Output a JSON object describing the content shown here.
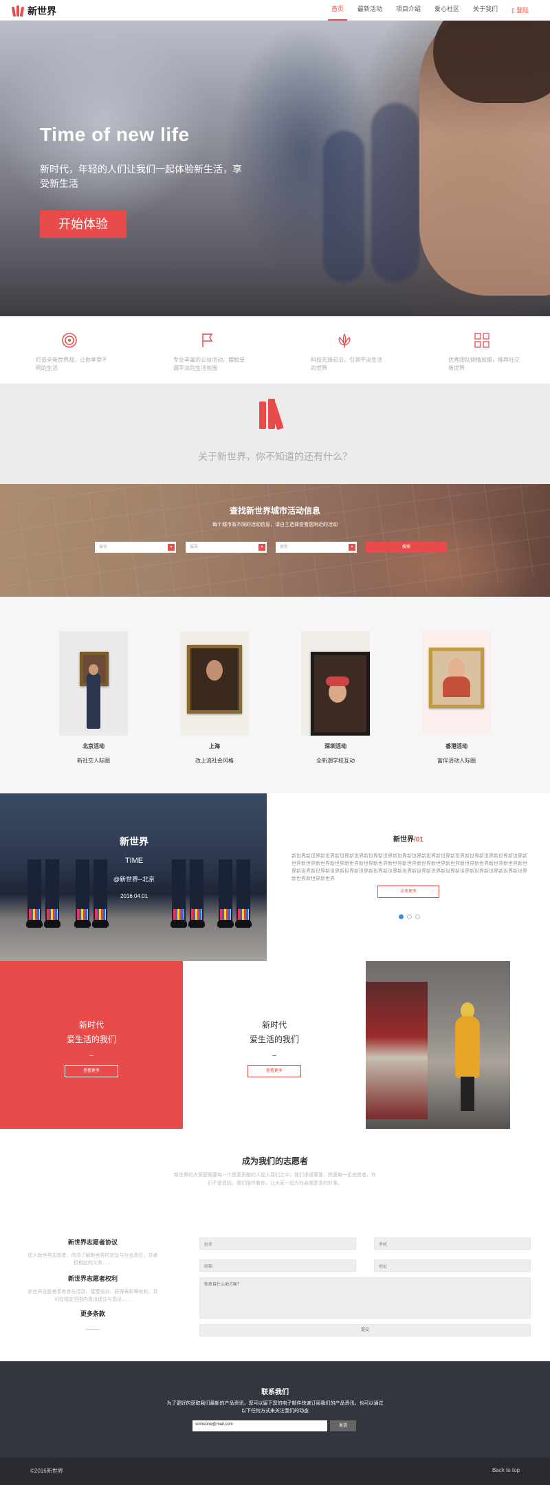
{
  "header": {
    "logo_text": "新世界",
    "nav": [
      "首页",
      "最新活动",
      "项目介绍",
      "爱心社区",
      "关于我们"
    ],
    "login": "登陆"
  },
  "hero": {
    "title": "Time of new life",
    "subtitle": "新时代，年轻的人们让我们一起体验新生活，享受新生活",
    "button": "开始体验"
  },
  "features": [
    "打造全新世界观，让你享受不同的生活",
    "专业丰富的公益活动，摆脱单调平淡的生活氛围",
    "科技先锋前沿，引领平淡生活的世界",
    "优秀团队倾情加盟，推荐社交新世界"
  ],
  "about": {
    "text": "关于新世界，你不知道的还有什么？"
  },
  "search": {
    "title": "查找新世界城市活动信息",
    "subtitle": "每个城市有不同的活动信息，请自主选择查看您附近的活动",
    "selects": [
      "省份",
      "城市",
      "类型"
    ],
    "button": "搜索"
  },
  "activities": [
    {
      "city": "北京活动",
      "desc": "新社交人际圈"
    },
    {
      "city": "上海",
      "desc": "改上流社会风格"
    },
    {
      "city": "深圳活动",
      "desc": "全新潮学校互动"
    },
    {
      "city": "香港活动",
      "desc": "富伴活动人际圈"
    }
  ],
  "story": {
    "overlay_title": "新世界",
    "overlay_word": "TIME",
    "overlay_place": "@新世界--北京",
    "overlay_date": "2016.04.01",
    "title": "新世界",
    "title_num": "/01",
    "body": "新世界新世界新世界新世界新世界新世界新世界新世界新世界新世界新世界新世界新世界新世界新世界新世界新世界新世界新世界新世界新世界新世界新世界新世界新世界新世界新世界新世界新世界新世界新世界新世界新世界新世界新世界新世界新世界新世界新世界新世界新世界新世界新世界新世界新世界新世界新世界新世界新世界新世界新世界新世界",
    "more": "点击更多"
  },
  "life": {
    "line1": "新时代",
    "line2": "爱生活的我们",
    "dash": "–",
    "button": "查看更多"
  },
  "volunteers": {
    "title": "成为我们的志愿者",
    "subtitle": "新世界的大家庭需要每一个愿意贡献的人加入我们之中，我们承诺尊重、热爱每一位志愿者，你们不是孤独，我们陪伴着你，让大家一起为社会做更多的好事。"
  },
  "agreements": {
    "h1": "新世界志愿者协议",
    "p1": "加入新世界志愿者，你须了解新世界的宗旨与社会责任，并承担相应的义务……",
    "h2": "新世界志愿者权利",
    "p2": "新世界志愿者享有参与活动、接受培训、获得表彰等权利，并可在规定范围内提出建议与意见……",
    "more": "更多条款"
  },
  "form": {
    "name": "姓名",
    "phone": "手机",
    "email": "邮箱",
    "address": "地址",
    "message": "你来自什么地方呢？",
    "submit": "提交"
  },
  "contact": {
    "title": "联系我们",
    "text": "为了更好的获取我们最新的产品资讯，您可以留下您的电子邮件快速订阅我们的产品资讯，也可以通过以下任何方式来关注我们的动态",
    "email_placeholder": "someone@mail.com",
    "send": "发送"
  },
  "footer": {
    "copy": "©2016新世界",
    "top": "Back to top"
  },
  "colors": {
    "accent": "#e94b4b",
    "dark": "#34363f",
    "footer": "#2a2b31"
  }
}
